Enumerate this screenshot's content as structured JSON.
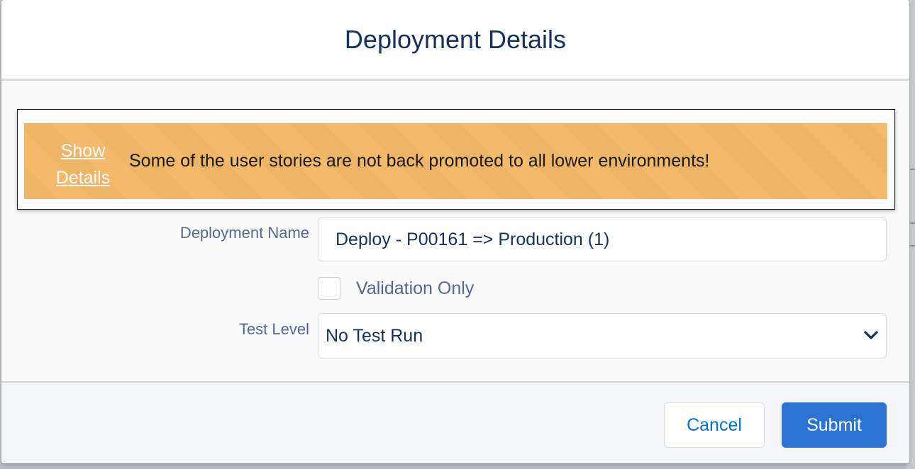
{
  "modal": {
    "title": "Deployment Details"
  },
  "alert": {
    "link_line1": "Show",
    "link_line2": "Details",
    "message": "Some of the user stories are not back promoted to all lower environments!"
  },
  "form": {
    "deployment_name_label": "Deployment Name",
    "deployment_name_value": "Deploy - P00161 => Production (1)",
    "validation_only_label": "Validation Only",
    "validation_only_checked": false,
    "test_level_label": "Test Level",
    "test_level_value": "No Test Run"
  },
  "footer": {
    "cancel_label": "Cancel",
    "submit_label": "Submit"
  },
  "colors": {
    "alert_background": "#f4b969",
    "title_text": "#16325c",
    "submit_background": "#2a74d0",
    "cancel_text": "#0070d2"
  },
  "icons": {
    "select": "chevron-down-icon"
  }
}
